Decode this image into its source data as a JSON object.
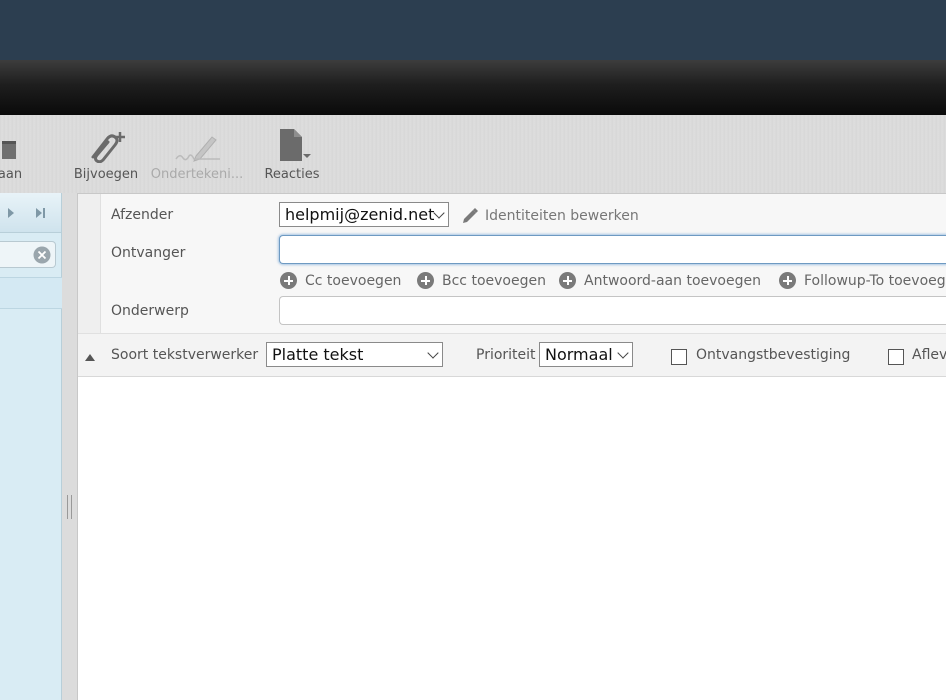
{
  "toolbar": {
    "partial_label": "aan",
    "attach_label": "Bijvoegen",
    "sign_label": "Ondertekeni...",
    "responses_label": "Reacties"
  },
  "compose": {
    "from_label": "Afzender",
    "from_value": "helpmij@zenid.net",
    "edit_identities": "Identiteiten bewerken",
    "to_label": "Ontvanger",
    "to_value": "",
    "add_cc": "Cc toevoegen",
    "add_bcc": "Bcc toevoegen",
    "add_replyto": "Antwoord-aan toevoegen",
    "add_followupto": "Followup-To toevoeg",
    "subject_label": "Onderwerp",
    "subject_value": ""
  },
  "options": {
    "editor_label": "Soort tekstverwerker",
    "editor_value": "Platte tekst",
    "priority_label": "Prioriteit",
    "priority_value": "Normaal",
    "receipt_label": "Ontvangstbevestiging",
    "dsn_label": "Aflev"
  },
  "colors": {
    "topbar": "#2c3e50",
    "left_panel": "#d9ecf4",
    "focus": "#6e9ac2"
  }
}
